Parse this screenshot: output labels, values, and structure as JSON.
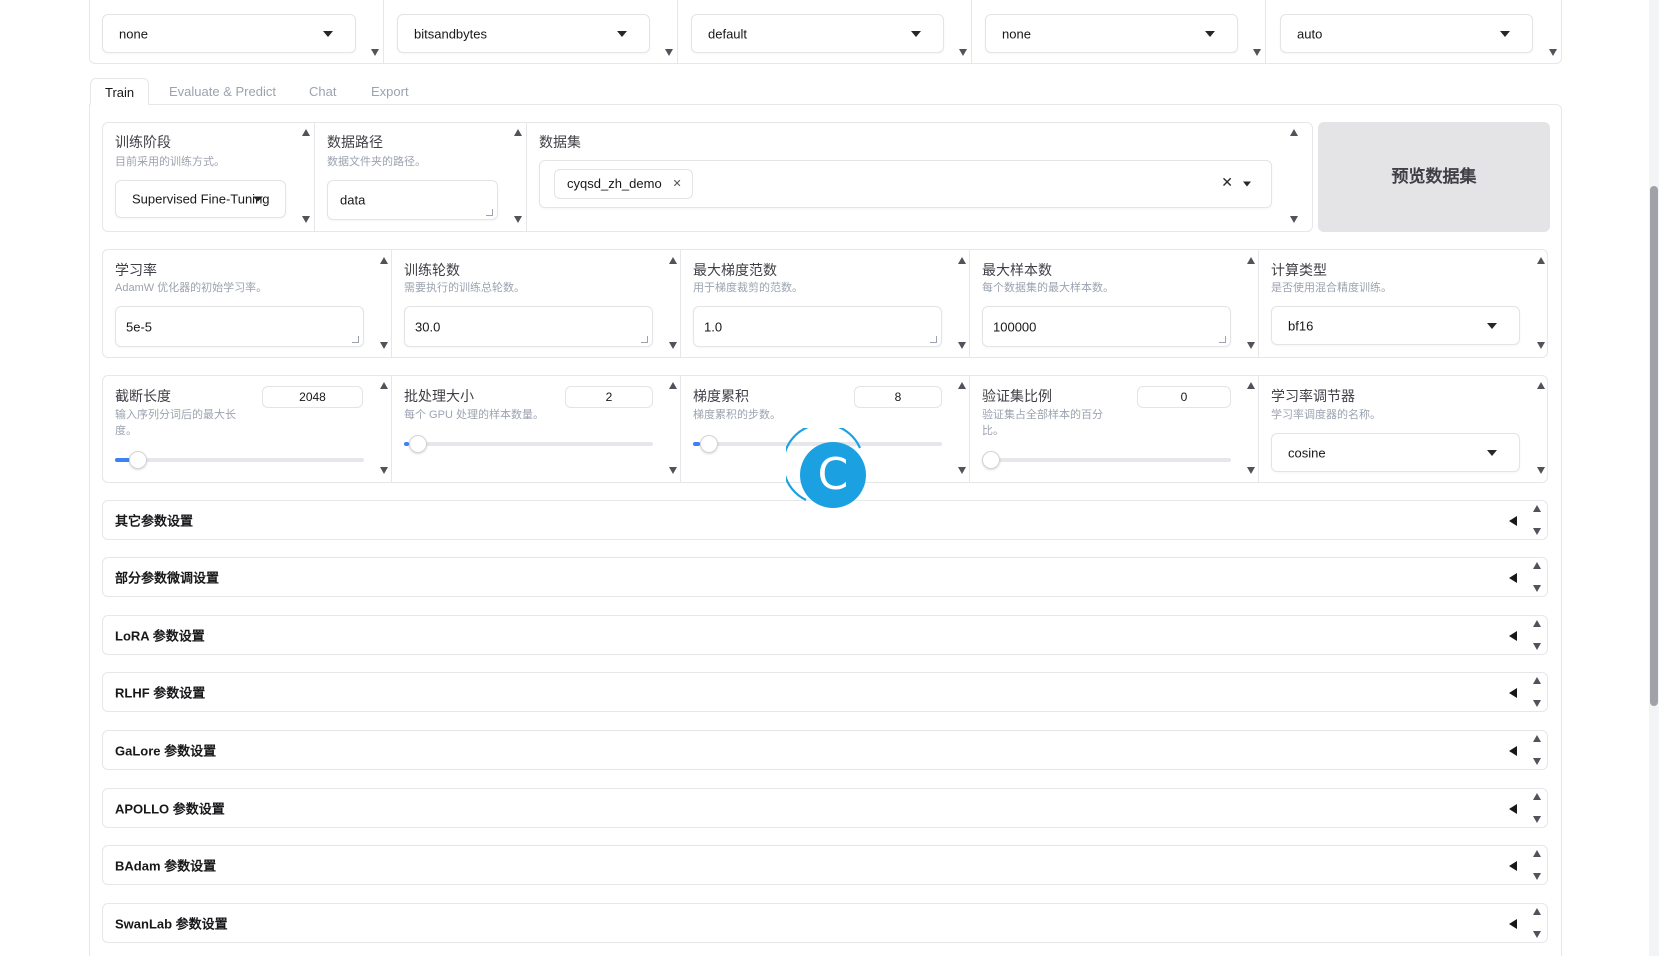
{
  "top_row": {
    "selects": [
      {
        "value": "none"
      },
      {
        "value": "bitsandbytes"
      },
      {
        "value": "default"
      },
      {
        "value": "none"
      },
      {
        "value": "auto"
      }
    ]
  },
  "tabs": [
    {
      "label": "Train"
    },
    {
      "label": "Evaluate & Predict"
    },
    {
      "label": "Chat"
    },
    {
      "label": "Export"
    }
  ],
  "train": {
    "stage": {
      "label": "训练阶段",
      "info": "目前采用的训练方式。",
      "value": "Supervised Fine-Tuning"
    },
    "dataset_dir": {
      "label": "数据路径",
      "info": "数据文件夹的路径。",
      "value": "data"
    },
    "dataset": {
      "label": "数据集",
      "chips": [
        "cyqsd_zh_demo"
      ]
    },
    "preview_button": "预览数据集",
    "learning_rate": {
      "label": "学习率",
      "info": "AdamW 优化器的初始学习率。",
      "value": "5e-5"
    },
    "epochs": {
      "label": "训练轮数",
      "info": "需要执行的训练总轮数。",
      "value": "30.0"
    },
    "max_grad_norm": {
      "label": "最大梯度范数",
      "info": "用于梯度裁剪的范数。",
      "value": "1.0"
    },
    "max_samples": {
      "label": "最大样本数",
      "info": "每个数据集的最大样本数。",
      "value": "100000"
    },
    "compute_type": {
      "label": "计算类型",
      "info": "是否使用混合精度训练。",
      "value": "bf16"
    },
    "cutoff_len": {
      "label": "截断长度",
      "info": "输入序列分词后的最大长度。",
      "value": "2048",
      "fraction": 0.06
    },
    "batch_size": {
      "label": "批处理大小",
      "info": "每个 GPU 处理的样本数量。",
      "value": "2",
      "fraction": 0.02
    },
    "grad_accum": {
      "label": "梯度累积",
      "info": "梯度累积的步数。",
      "value": "8",
      "fraction": 0.03
    },
    "val_size": {
      "label": "验证集比例",
      "info": "验证集占全部样本的百分比。",
      "value": "0",
      "fraction": 0.0
    },
    "lr_scheduler": {
      "label": "学习率调节器",
      "info": "学习率调度器的名称。",
      "value": "cosine"
    }
  },
  "accordions": [
    {
      "label": "其它参数设置"
    },
    {
      "label": "部分参数微调设置"
    },
    {
      "label": "LoRA 参数设置"
    },
    {
      "label": "RLHF 参数设置"
    },
    {
      "label": "GaLore 参数设置"
    },
    {
      "label": "APOLLO 参数设置"
    },
    {
      "label": "BAdam 参数设置"
    },
    {
      "label": "SwanLab 参数设置"
    }
  ],
  "overlay": {
    "letter": "C"
  },
  "colors": {
    "accent": "#3b82f6",
    "overlay": "#1ba1e2",
    "border": "#e5e7eb"
  }
}
